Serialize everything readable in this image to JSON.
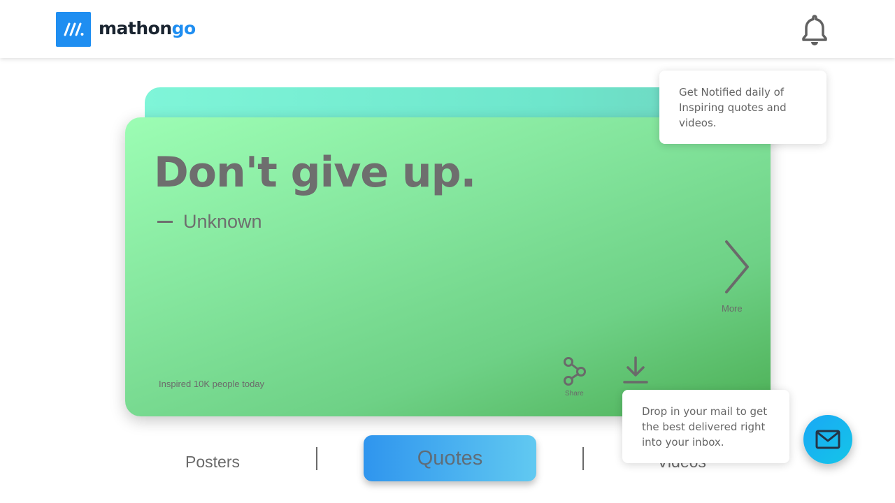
{
  "header": {
    "logo_text_main": "mathon",
    "logo_text_accent": "go",
    "logo_icon": "mathongo-logo-icon",
    "notification_icon": "bell-icon"
  },
  "card": {
    "quote": "Don't give up.",
    "author": "Unknown",
    "inspired_text": "Inspired 10K people today",
    "more_label": "More",
    "share_label": "Share",
    "download_icon": "download-icon"
  },
  "tooltips": {
    "notify": "Get Notified daily of Inspiring quotes and videos.",
    "mail": "Drop in your mail to get the best delivered right into your inbox."
  },
  "tabs": {
    "posters": "Posters",
    "quotes": "Quotes",
    "videos": "Videos",
    "active": "Quotes"
  },
  "colors": {
    "brand": "#1f8ef1",
    "card_gradient_start": "#9cfdb4",
    "card_gradient_end": "#4caf55",
    "back_card": "#7ff5d8",
    "active_tab_start": "#2f95ee",
    "active_tab_end": "#61c9f1",
    "mail_fab": "#1aa8f5"
  },
  "fab": {
    "icon": "mail-icon"
  }
}
